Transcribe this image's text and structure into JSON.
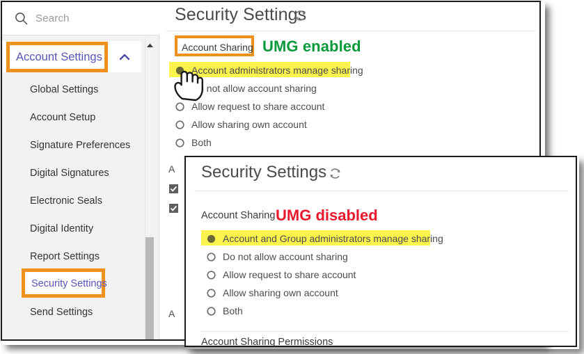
{
  "sidebar": {
    "search": {
      "placeholder": "Search",
      "icon": "search-icon"
    },
    "account_settings": {
      "label": "Account Settings",
      "chevron": "chevron-up-icon",
      "expanded": true
    },
    "items": [
      {
        "label": "Global Settings"
      },
      {
        "label": "Account Setup"
      },
      {
        "label": "Signature Preferences"
      },
      {
        "label": "Digital Signatures"
      },
      {
        "label": "Electronic Seals"
      },
      {
        "label": "Digital Identity"
      },
      {
        "label": "Report Settings"
      },
      {
        "label": "Security Settings",
        "highlighted": true
      },
      {
        "label": "Send Settings"
      }
    ],
    "scrollbar": {
      "up_arrow_icon": "scroll-up-arrow-icon"
    }
  },
  "back_window": {
    "title": "Security Settings",
    "refresh_icon": "refresh-icon",
    "section_label": "Account Sharing",
    "annotation": "UMG enabled",
    "annotation_color": "#0a9a3c",
    "options": [
      {
        "label": "Account administrators manage sharing",
        "selected": true,
        "highlighted": true
      },
      {
        "label": "Do not allow account sharing",
        "selected": false
      },
      {
        "label": "Allow request to share account",
        "selected": false
      },
      {
        "label": "Allow sharing own account",
        "selected": false
      },
      {
        "label": "Both",
        "selected": false
      }
    ],
    "obscured_text_1": "A",
    "obscured_text_2": "A"
  },
  "front_window": {
    "title": "Security Settings",
    "refresh_icon": "refresh-icon",
    "section_label": "Account Sharing",
    "annotation": "UMG disabled",
    "annotation_color": "#e8192c",
    "options": [
      {
        "label": "Account and Group administrators manage sharing",
        "selected": true,
        "highlighted": true
      },
      {
        "label": "Do not allow account sharing",
        "selected": false
      },
      {
        "label": "Allow request to share account",
        "selected": false
      },
      {
        "label": "Allow sharing own account",
        "selected": false
      },
      {
        "label": "Both",
        "selected": false
      }
    ],
    "permissions_label": "Account Sharing Permissions"
  },
  "cursor": {
    "icon": "hand-pointer-cursor"
  },
  "colors": {
    "highlight_box": "#f0911e",
    "selection_yellow": "#fcf34d",
    "link_purple": "#5855b8"
  }
}
